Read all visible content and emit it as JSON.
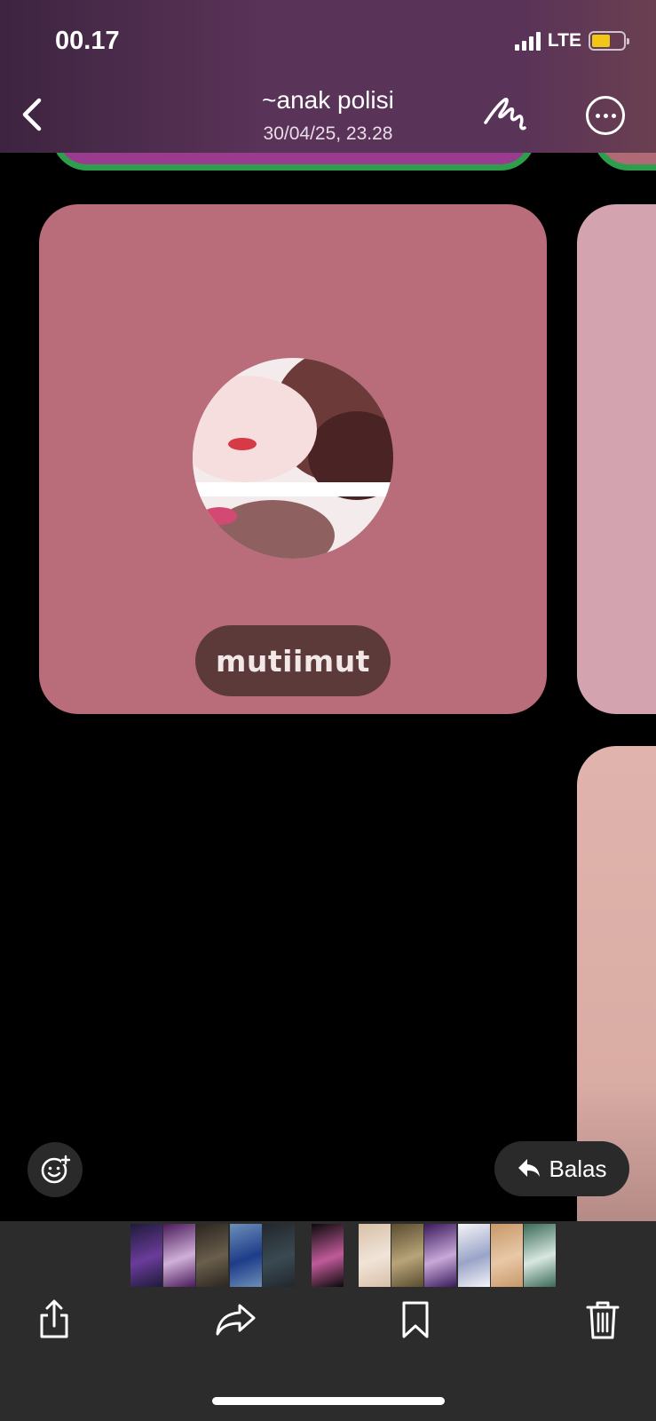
{
  "status_bar": {
    "time": "00.17",
    "network": "LTE"
  },
  "header": {
    "title": "~anak polisi",
    "date": "30/04/25, 23.28",
    "back_icon": "chevron-left-icon",
    "markup_icon": "markup-scribble-icon",
    "more_icon": "ellipsis-circle-icon"
  },
  "photo": {
    "profile_name": "mutiimut"
  },
  "actions": {
    "react_icon": "emoji-add-icon",
    "reply_label": "Balas",
    "reply_icon": "reply-arrow-icon"
  },
  "toolbar": {
    "share_icon": "share-icon",
    "forward_icon": "forward-icon",
    "bookmark_icon": "bookmark-icon",
    "delete_icon": "trash-icon"
  },
  "thumbnails": [
    {
      "colors": [
        "#1e1b3a",
        "#6a3c9a"
      ]
    },
    {
      "colors": [
        "#4a1a5a",
        "#d0b0d8"
      ]
    },
    {
      "colors": [
        "#2b2620",
        "#6a5e4c"
      ]
    },
    {
      "colors": [
        "#6c8fb8",
        "#1d3c8a"
      ]
    },
    {
      "colors": [
        "#22272c",
        "#3a4a52"
      ]
    },
    {
      "colors": [
        "#0a0a0a",
        "#c05a9a"
      ]
    },
    {
      "colors": [
        "#d8c0a8",
        "#f0e4d8"
      ]
    },
    {
      "colors": [
        "#5a4c30",
        "#b8a478"
      ]
    },
    {
      "colors": [
        "#3a1a5c",
        "#c8a8d8"
      ]
    },
    {
      "colors": [
        "#f4f4f8",
        "#9aa4c8"
      ]
    },
    {
      "colors": [
        "#c89868",
        "#e8c8a8"
      ]
    },
    {
      "colors": [
        "#3a6a58",
        "#d8e8e0"
      ]
    }
  ]
}
